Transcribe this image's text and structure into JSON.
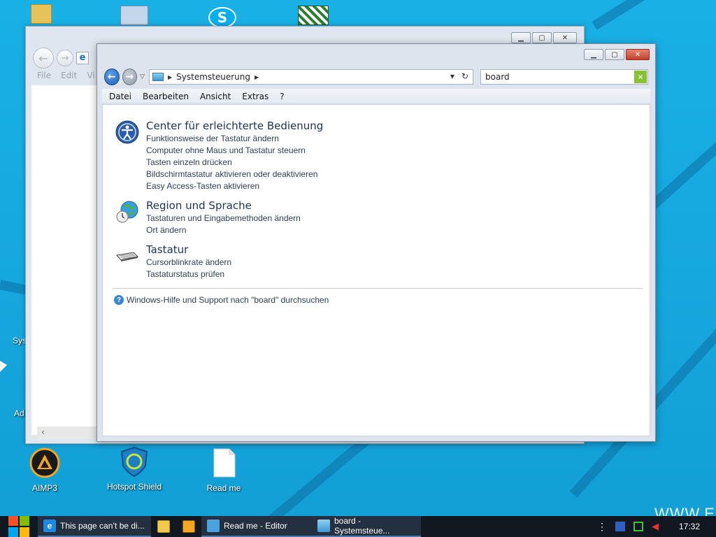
{
  "desktop": {
    "icons": [
      {
        "label": "AIMP3",
        "icon": "aimp3-icon"
      },
      {
        "label": "Hotspot Shield",
        "icon": "hotspot-shield-icon"
      },
      {
        "label": "Read me",
        "icon": "text-document-icon"
      }
    ],
    "partial_labels": [
      "Sys",
      "Ad"
    ],
    "watermark": "WWW.E"
  },
  "back_window": {
    "menu": [
      "File",
      "Edit",
      "Vi"
    ]
  },
  "explorer": {
    "breadcrumb": "Systemsteuerung",
    "search_value": "board",
    "search_clear": "×",
    "menu": [
      "Datei",
      "Bearbeiten",
      "Ansicht",
      "Extras",
      "?"
    ],
    "categories": [
      {
        "title": "Center für erleichterte Bedienung",
        "icon": "ease-of-access-icon",
        "links": [
          "Funktionsweise der Tastatur ändern",
          "Computer ohne Maus und Tastatur steuern",
          "Tasten einzeln drücken",
          "Bildschirmtastatur aktivieren oder deaktivieren",
          "Easy Access-Tasten aktivieren"
        ]
      },
      {
        "title": "Region und Sprache",
        "icon": "globe-clock-icon",
        "links": [
          "Tastaturen und Eingabemethoden ändern",
          "Ort ändern"
        ]
      },
      {
        "title": "Tastatur",
        "icon": "keyboard-icon",
        "links": [
          "Cursorblinkrate ändern",
          "Tastaturstatus prüfen"
        ]
      }
    ],
    "help_link": "Windows-Hilfe und Support nach \"board\" durchsuchen"
  },
  "taskbar": {
    "tasks": [
      {
        "label": "This page can’t be di...",
        "icon": "internet-explorer-icon"
      },
      {
        "label": "Read me - Editor",
        "icon": "notepad-icon"
      },
      {
        "label": "board - Systemsteue...",
        "icon": "control-panel-icon"
      }
    ],
    "clock": "17:32"
  },
  "colors": {
    "desktop": "#16a6d9",
    "taskbar": "#101821",
    "link_text": "#2d3d55"
  }
}
